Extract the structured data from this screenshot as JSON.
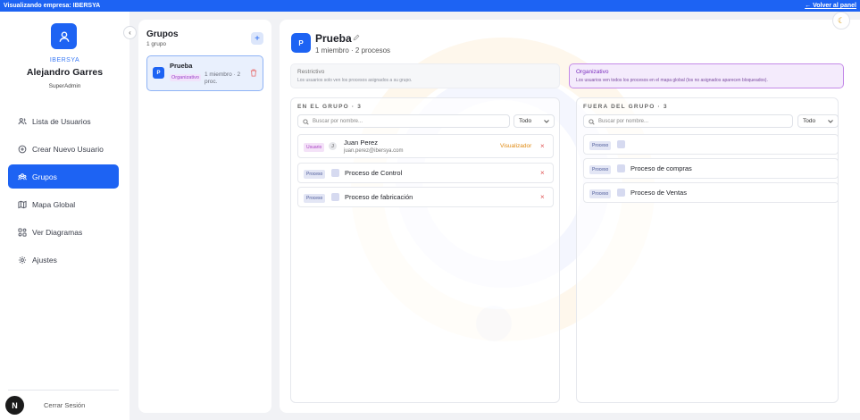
{
  "topbar": {
    "left_text": "Visualizando empresa: IBERSYA",
    "back_link": "← Volver al panel"
  },
  "sidebar": {
    "company": "IBERSYA",
    "user_name": "Alejandro Garres",
    "role": "SuperAdmin",
    "items": [
      {
        "label": "Lista de Usuarios",
        "icon": "users-icon"
      },
      {
        "label": "Crear Nuevo Usuario",
        "icon": "plus-circle-icon"
      },
      {
        "label": "Grupos",
        "icon": "groups-icon"
      },
      {
        "label": "Mapa Global",
        "icon": "map-icon"
      },
      {
        "label": "Ver Diagramas",
        "icon": "diagram-icon"
      },
      {
        "label": "Ajustes",
        "icon": "gear-icon"
      }
    ],
    "logout": "Cerrar Sesión",
    "badge": "N"
  },
  "groups": {
    "title": "Grupos",
    "count": "1 grupo",
    "add": "+",
    "cards": [
      {
        "initial": "P",
        "name": "Prueba",
        "type": "Organizativo",
        "stats": "1 miembro · 2 proc."
      }
    ]
  },
  "detail": {
    "initial": "P",
    "title": "Prueba",
    "subtitle": "1 miembro · 2 procesos",
    "modes": {
      "restrictive": {
        "title": "Restrictivo",
        "desc": "Los usuarios solo ven los procesos asignados a su grupo."
      },
      "organizational": {
        "title": "Organizativo",
        "desc": "Los usuarios ven todos los procesos en el mapa global (los no asignados aparecen bloqueados)."
      }
    },
    "in_group": {
      "header": "EN EL GRUPO · 3",
      "search_placeholder": "Buscar por nombre...",
      "filter": "Todo",
      "rows": [
        {
          "tag": "Usuario",
          "initial": "J",
          "name": "Juan Perez",
          "email": "juan.perez@ibersya.com",
          "role": "Visualizador",
          "remove": "×"
        },
        {
          "tag": "Proceso",
          "name": "Proceso de Control",
          "remove": "×"
        },
        {
          "tag": "Proceso",
          "name": "Proceso de fabricación",
          "remove": "×"
        }
      ]
    },
    "out_group": {
      "header": "FUERA DEL GRUPO · 3",
      "search_placeholder": "Buscar por nombre...",
      "filter": "Todo",
      "rows": [
        {
          "tag": "Proceso",
          "name": ""
        },
        {
          "tag": "Proceso",
          "name": "Proceso de compras"
        },
        {
          "tag": "Proceso",
          "name": "Proceso de Ventas"
        }
      ]
    }
  },
  "colors": {
    "accent": "#1d63f3",
    "organizational": "#7b2fbe",
    "role_accent": "#e08a12",
    "danger": "#e05555"
  }
}
